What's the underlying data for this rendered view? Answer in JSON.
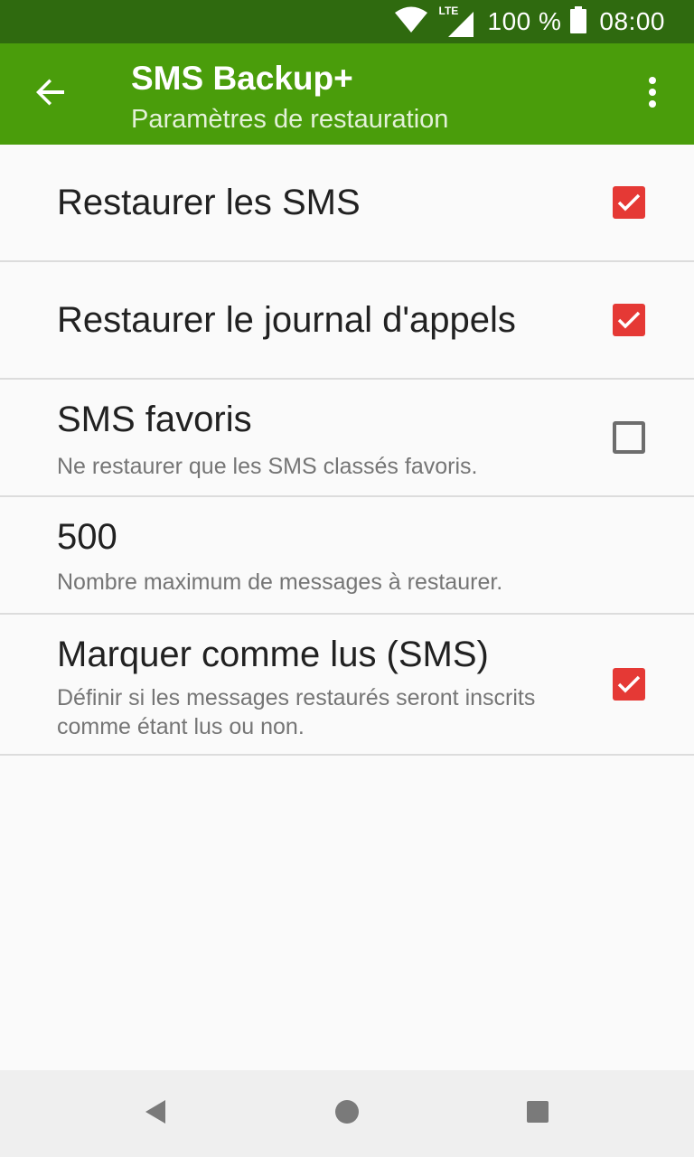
{
  "status_bar": {
    "network_label": "LTE",
    "battery_text": "100 %",
    "time": "08:00",
    "icons": [
      "wifi-icon",
      "cell-signal-icon",
      "battery-icon"
    ]
  },
  "app_bar": {
    "title": "SMS Backup+",
    "subtitle": "Paramètres de restauration",
    "back_icon": "arrow-left-icon",
    "menu_icon": "more-vert-icon",
    "color": "#4a9d0b",
    "status_color": "#2f6a0f"
  },
  "preferences": [
    {
      "title": "Restaurer les SMS",
      "summary": "",
      "checked": true
    },
    {
      "title": "Restaurer le journal d'appels",
      "summary": "",
      "checked": true
    },
    {
      "title": "SMS favoris",
      "summary": "Ne restaurer que les SMS classés favoris.",
      "checked": false
    },
    {
      "title": "500",
      "summary": "Nombre maximum de messages à restaurer."
    },
    {
      "title": "Marquer comme lus (SMS)",
      "summary": "Définir si les messages restaurés seront inscrits comme étant lus ou non.",
      "checked": true
    }
  ],
  "accent_color": "#e53935",
  "nav_bar": {
    "icons": [
      "back-triangle-icon",
      "home-circle-icon",
      "recents-square-icon"
    ]
  }
}
